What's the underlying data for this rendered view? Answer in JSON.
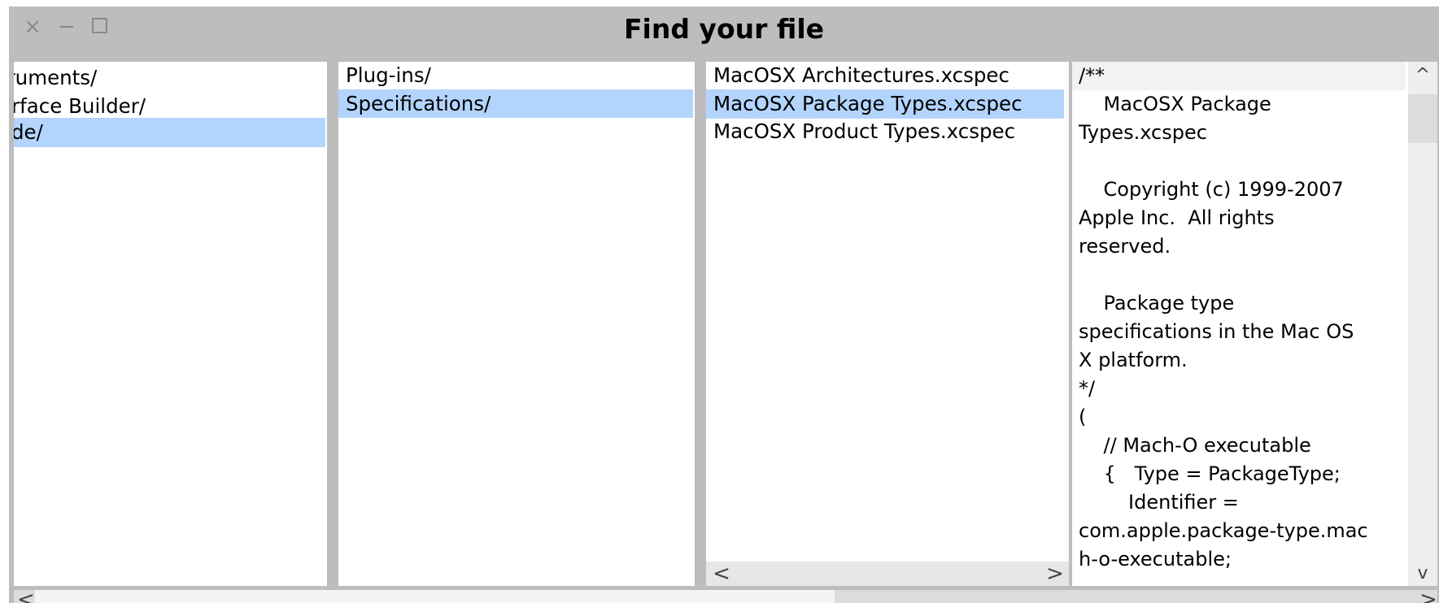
{
  "window": {
    "title": "Find your file",
    "controls": {
      "close": "×",
      "minimize": "−",
      "maximize": ""
    }
  },
  "columns": {
    "col1": {
      "items": [
        {
          "label": "truments/",
          "selected": false
        },
        {
          "label": "erface Builder/",
          "selected": false
        },
        {
          "label": "ode/",
          "selected": true
        }
      ]
    },
    "col2": {
      "items": [
        {
          "label": "Plug-ins/",
          "selected": false
        },
        {
          "label": "Specifications/",
          "selected": true
        }
      ]
    },
    "col3": {
      "items": [
        {
          "label": "MacOSX Architectures.xcspec",
          "selected": false
        },
        {
          "label": "MacOSX Package Types.xcspec",
          "selected": true
        },
        {
          "label": "MacOSX Product Types.xcspec",
          "selected": false
        }
      ],
      "scroll_left": "<",
      "scroll_right": ">"
    }
  },
  "preview": {
    "lines": [
      "/**",
      "    MacOSX Package",
      "Types.xcspec",
      "",
      "    Copyright (c) 1999-2007",
      "Apple Inc.  All rights",
      "reserved.",
      "",
      "    Package type",
      "specifications in the Mac OS",
      "X platform.",
      "*/",
      "(",
      "    // Mach-O executable",
      "    {   Type = PackageType;",
      "        Identifier =",
      "com.apple.package-type.mac",
      "h-o-executable;"
    ],
    "scroll_up": "^",
    "scroll_down": "v"
  },
  "main_scroll": {
    "left": "<",
    "right": ">"
  }
}
